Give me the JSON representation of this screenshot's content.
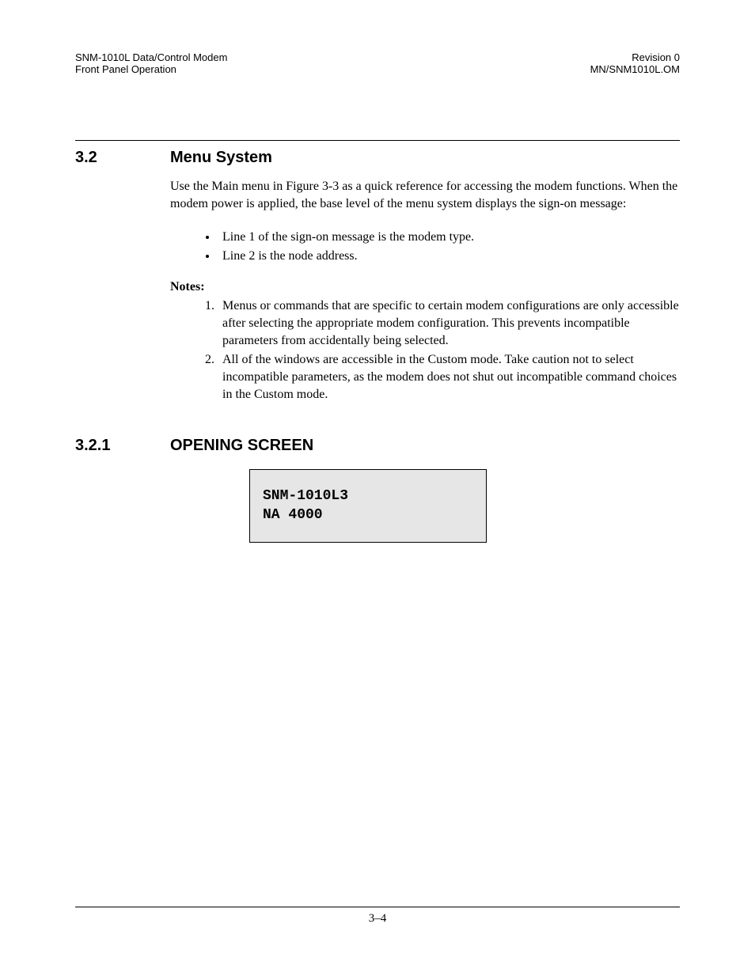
{
  "header": {
    "left_line1": "SNM-1010L Data/Control Modem",
    "left_line2": "Front Panel Operation",
    "right_line1": "Revision 0",
    "right_line2": "MN/SNM1010L.OM"
  },
  "section": {
    "number": "3.2",
    "title": "Menu System",
    "paragraph": "Use the Main menu in                            Figure 3-3 as a quick reference for accessing the modem functions. When the modem power is applied, the base level of the menu system displays the sign-on message:"
  },
  "bullets": [
    "Line 1 of the sign-on message is the modem type.",
    "Line 2 is the node address."
  ],
  "notes_label": "Notes:",
  "notes": [
    "Menus or commands that are specific to certain modem configurations are only accessible after selecting the appropriate modem configuration. This prevents incompatible parameters from accidentally being selected.",
    "All of the windows are accessible in the Custom mode. Take caution not to select incompatible parameters, as the modem does not shut out incompatible command choices in the Custom mode."
  ],
  "subsection": {
    "number": "3.2.1",
    "title": "OPENING SCREEN"
  },
  "screen": {
    "line1": "SNM-1010L3",
    "line2": "NA 4000"
  },
  "footer": {
    "page": "3–4"
  }
}
